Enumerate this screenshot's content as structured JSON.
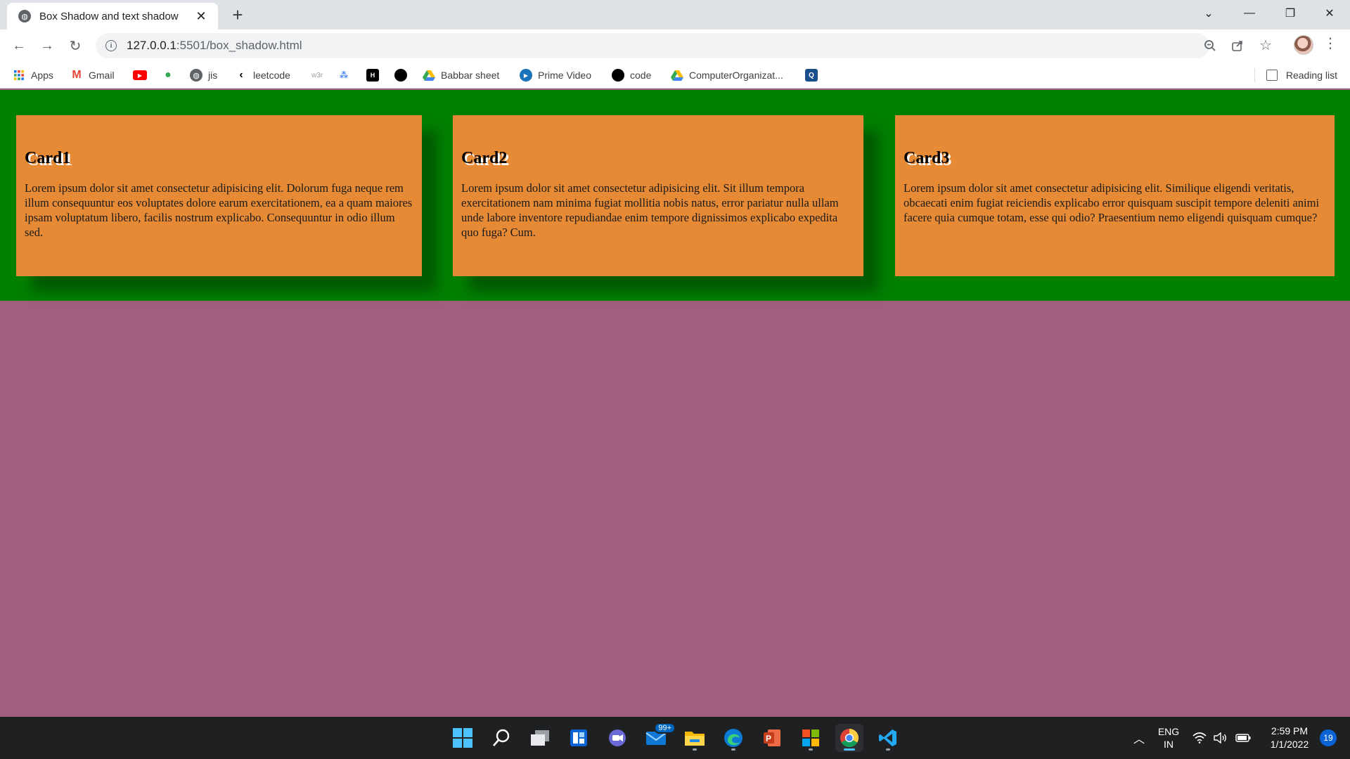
{
  "browser": {
    "tab_title": "Box Shadow and text shadow",
    "url_host": "127.0.0.1",
    "url_rest": ":5501/box_shadow.html",
    "reading_list": "Reading list"
  },
  "bookmarks": [
    {
      "label": "Apps",
      "icon": "apps-grid-icon"
    },
    {
      "label": "Gmail",
      "icon": "gmail-icon"
    },
    {
      "label": "",
      "icon": "youtube-icon"
    },
    {
      "label": "",
      "icon": "maps-pin-icon"
    },
    {
      "label": "jis",
      "icon": "globe-icon"
    },
    {
      "label": "leetcode",
      "icon": "leetcode-icon"
    },
    {
      "label": "",
      "icon": "w3schools-icon"
    },
    {
      "label": "",
      "icon": "graph-icon"
    },
    {
      "label": "",
      "icon": "hackerrank-icon"
    },
    {
      "label": "",
      "icon": "github-icon"
    },
    {
      "label": "Babbar sheet",
      "icon": "google-drive-icon"
    },
    {
      "label": "Prime Video",
      "icon": "prime-video-icon"
    },
    {
      "label": "code",
      "icon": "github-icon"
    },
    {
      "label": "ComputerOrganizat...",
      "icon": "google-drive-icon"
    },
    {
      "label": "",
      "icon": "search-bookmark-icon"
    }
  ],
  "cards": [
    {
      "title": "Card1",
      "text": "Lorem ipsum dolor sit amet consectetur adipisicing elit. Dolorum fuga neque rem illum consequuntur eos voluptates dolore earum exercitationem, ea a quam maiores ipsam voluptatum libero, facilis nostrum explicabo. Consequuntur in odio illum sed."
    },
    {
      "title": "Card2",
      "text": "Lorem ipsum dolor sit amet consectetur adipisicing elit. Sit illum tempora exercitationem nam minima fugiat mollitia nobis natus, error pariatur nulla ullam unde labore inventore repudiandae enim tempore dignissimos explicabo expedita quo fuga? Cum."
    },
    {
      "title": "Card3",
      "text": "Lorem ipsum dolor sit amet consectetur adipisicing elit. Similique eligendi veritatis, obcaecati enim fugiat reiciendis explicabo error quisquam suscipit tempore deleniti animi facere quia cumque totam, esse qui odio? Praesentium nemo eligendi quisquam cumque?"
    }
  ],
  "taskbar": {
    "mail_badge": "99+",
    "lang_1": "ENG",
    "lang_2": "IN",
    "time": "2:59 PM",
    "date": "1/1/2022",
    "notification_count": "19"
  },
  "colors": {
    "band_green": "#008000",
    "card_orange": "#e68a36",
    "page_mauve": "#a15f7d"
  }
}
